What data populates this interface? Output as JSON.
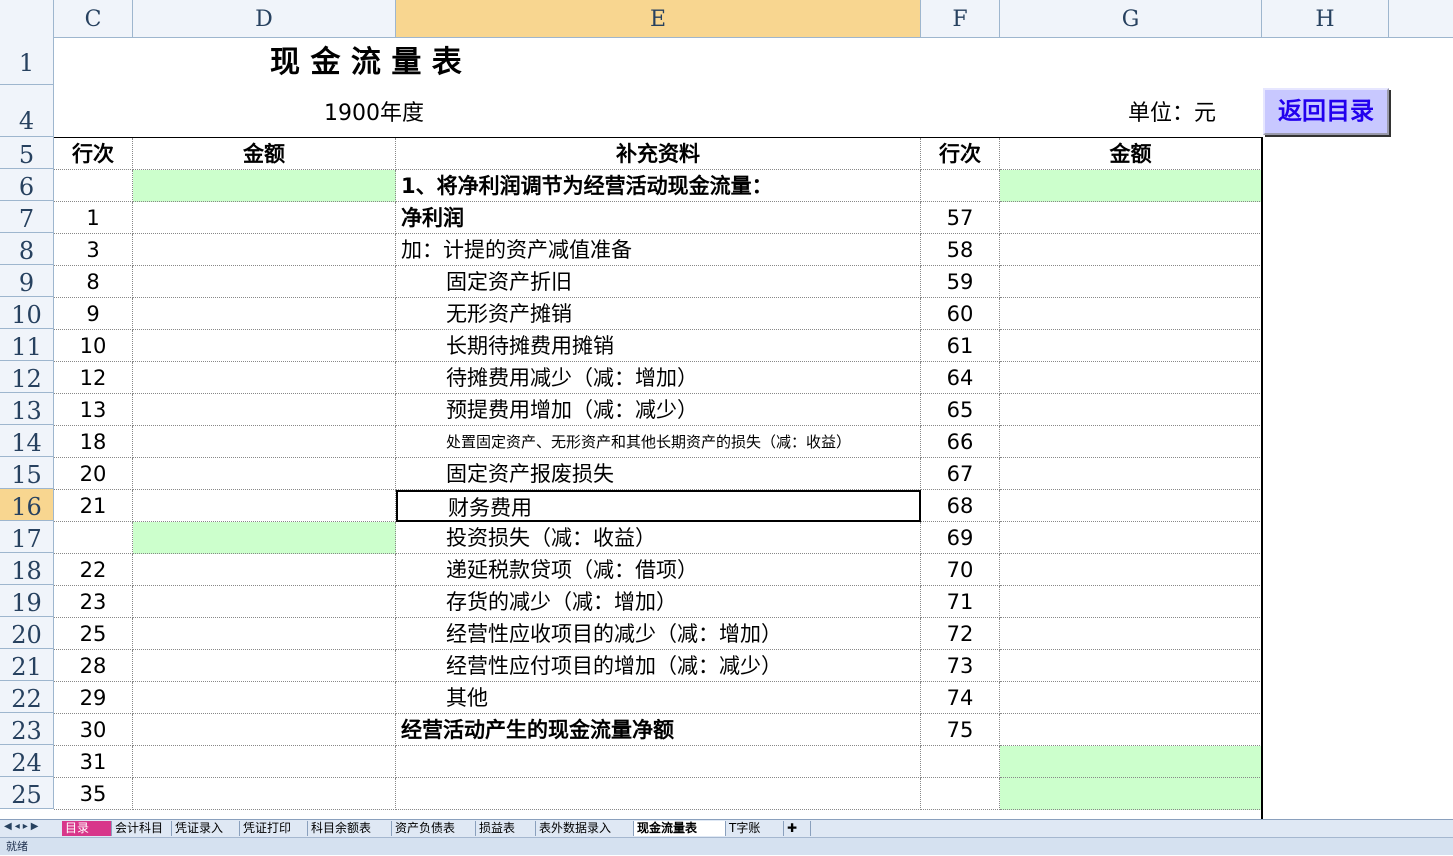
{
  "columns": [
    "C",
    "D",
    "E",
    "F",
    "G",
    "H"
  ],
  "row_numbers": [
    "1",
    "4",
    "5",
    "6",
    "7",
    "8",
    "9",
    "10",
    "11",
    "12",
    "13",
    "14",
    "15",
    "16",
    "17",
    "18",
    "19",
    "20",
    "21",
    "22",
    "23",
    "24",
    "25"
  ],
  "sheet": {
    "title": "现 金 流 量 表",
    "year": "1900年度",
    "unit": "单位：元",
    "back_button": "返回目录",
    "headers": {
      "c": "行次",
      "d": "金额",
      "e": "补充资料",
      "f": "行次",
      "g": "金额"
    },
    "rows": [
      {
        "c": "",
        "e": "1、将净利润调节为经营活动现金流量：",
        "f": ""
      },
      {
        "c": "1",
        "e": "净利润",
        "f": "57"
      },
      {
        "c": "3",
        "e": "加：计提的资产减值准备",
        "f": "58"
      },
      {
        "c": "8",
        "e": "固定资产折旧",
        "f": "59"
      },
      {
        "c": "9",
        "e": "无形资产摊销",
        "f": "60"
      },
      {
        "c": "10",
        "e": "长期待摊费用摊销",
        "f": "61"
      },
      {
        "c": "12",
        "e": "待摊费用减少（减：增加）",
        "f": "64"
      },
      {
        "c": "13",
        "e": "预提费用增加（减：减少）",
        "f": "65"
      },
      {
        "c": "18",
        "e": "处置固定资产、无形资产和其他长期资产的损失（减：收益）",
        "f": "66"
      },
      {
        "c": "20",
        "e": "固定资产报废损失",
        "f": "67"
      },
      {
        "c": "21",
        "e": "财务费用",
        "f": "68"
      },
      {
        "c": "",
        "e": "投资损失（减：收益）",
        "f": "69"
      },
      {
        "c": "22",
        "e": "递延税款贷项（减：借项）",
        "f": "70"
      },
      {
        "c": "23",
        "e": "存货的减少（减：增加）",
        "f": "71"
      },
      {
        "c": "25",
        "e": "经营性应收项目的减少（减：增加）",
        "f": "72"
      },
      {
        "c": "28",
        "e": "经营性应付项目的增加（减：减少）",
        "f": "73"
      },
      {
        "c": "29",
        "e": "其他",
        "f": "74"
      },
      {
        "c": "30",
        "e": "经营活动产生的现金流量净额",
        "f": "75"
      },
      {
        "c": "31",
        "e": "",
        "f": ""
      },
      {
        "c": "35",
        "e": "",
        "f": ""
      }
    ]
  },
  "tabs": [
    "目录",
    "会计科目",
    "凭证录入",
    "凭证打印",
    "科目余额表",
    "资产负债表",
    "损益表",
    "表外数据录入",
    "现金流量表",
    "T字账"
  ],
  "active_tab": "现金流量表",
  "status": "就绪"
}
